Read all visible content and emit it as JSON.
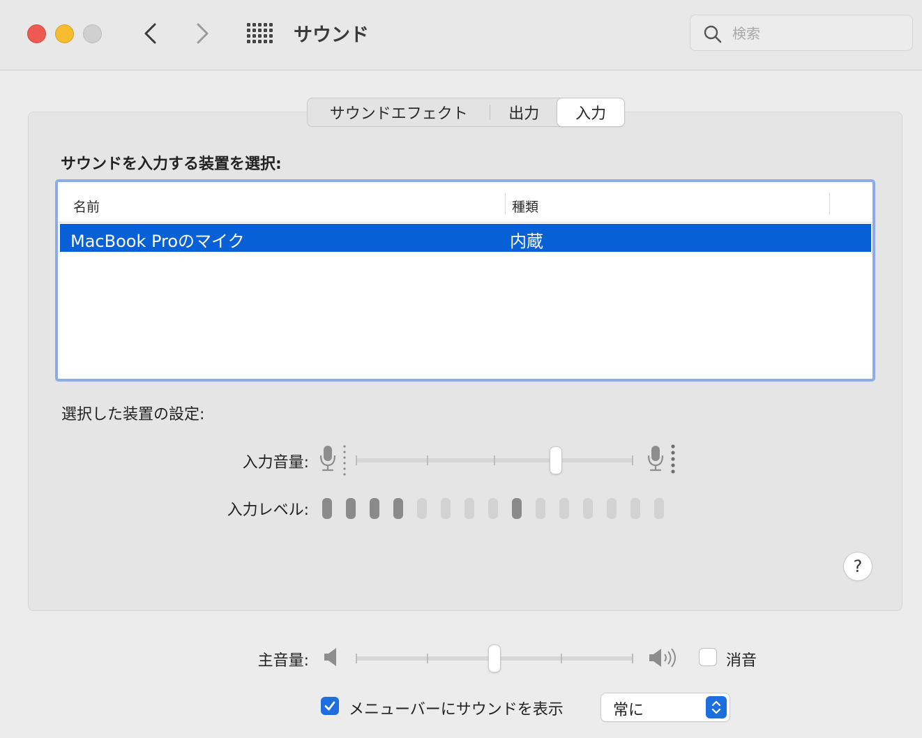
{
  "window": {
    "title": "サウンド",
    "search_placeholder": "検索"
  },
  "tabs": [
    {
      "label": "サウンドエフェクト",
      "selected": false
    },
    {
      "label": "出力",
      "selected": false
    },
    {
      "label": "入力",
      "selected": true
    }
  ],
  "input_devices": {
    "section_title": "サウンドを入力する装置を選択:",
    "columns": [
      "名前",
      "種類"
    ],
    "rows": [
      {
        "name": "MacBook Proのマイク",
        "type": "内蔵",
        "selected": true
      }
    ]
  },
  "device_settings": {
    "title": "選択した装置の設定:",
    "input_volume_label": "入力音量:",
    "input_volume_fraction": 0.72,
    "input_level_label": "入力レベル:",
    "input_level_segments": [
      1,
      1,
      1,
      1,
      0,
      0,
      0,
      0,
      1,
      0,
      0,
      0,
      0,
      0,
      0
    ]
  },
  "help_label": "?",
  "output": {
    "main_volume_label": "主音量:",
    "main_volume_fraction": 0.5,
    "mute_label": "消音",
    "mute_checked": false,
    "show_in_menubar_label": "メニューバーにサウンドを表示",
    "show_in_menubar_checked": true,
    "show_option": "常に"
  },
  "colors": {
    "selection": "#0760d6",
    "accent": "#1d6fe0",
    "focus_ring": "#8cabe8"
  }
}
